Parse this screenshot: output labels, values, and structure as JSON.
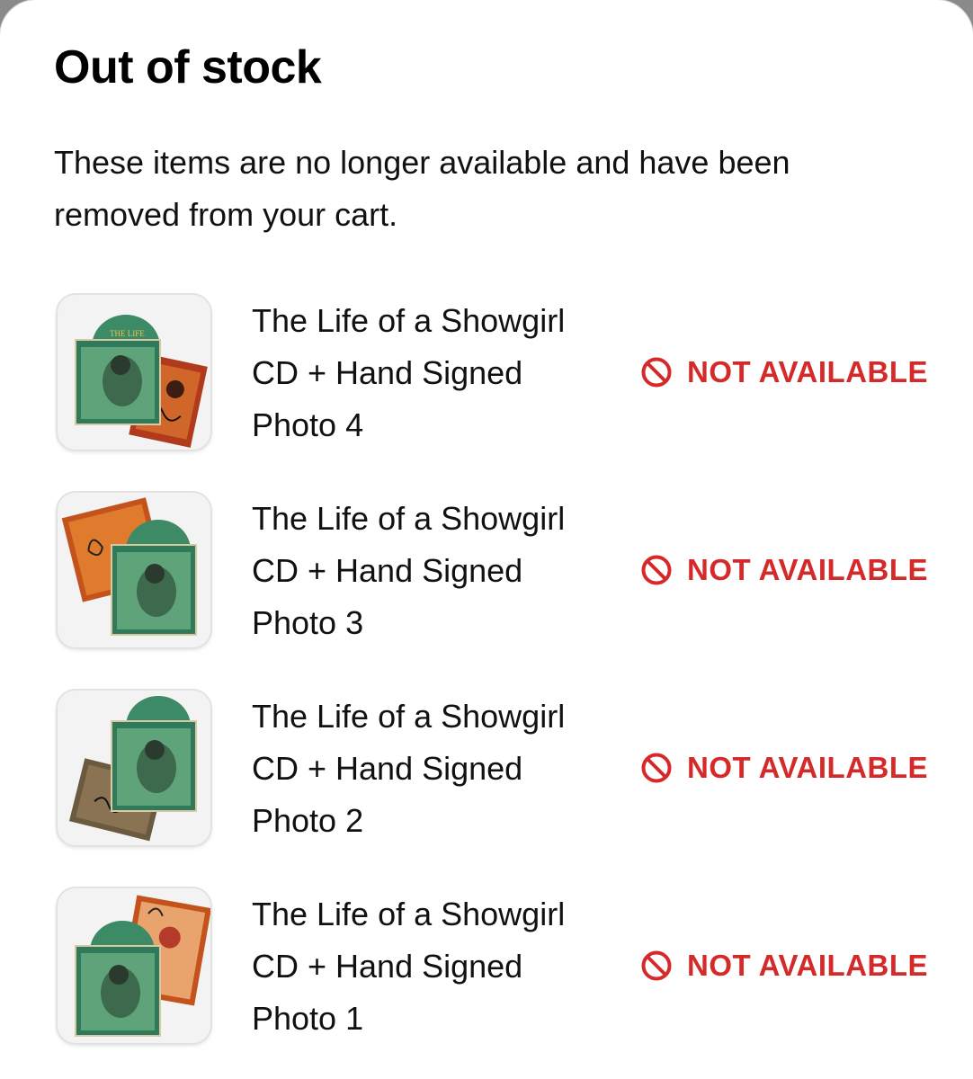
{
  "modal": {
    "title": "Out of stock",
    "message": "These items are no longer available and have been removed from your cart."
  },
  "items": [
    {
      "name": "The Life of a Showgirl CD + Hand Signed Photo 4",
      "status": "NOT AVAILABLE",
      "thumbnail_icon": "album-cd-signed-photo-image"
    },
    {
      "name": "The Life of a Showgirl CD + Hand Signed Photo 3",
      "status": "NOT AVAILABLE",
      "thumbnail_icon": "album-cd-signed-photo-image"
    },
    {
      "name": "The Life of a Showgirl CD + Hand Signed Photo 2",
      "status": "NOT AVAILABLE",
      "thumbnail_icon": "album-cd-signed-photo-image"
    },
    {
      "name": "The Life of a Showgirl CD + Hand Signed Photo 1",
      "status": "NOT AVAILABLE",
      "thumbnail_icon": "album-cd-signed-photo-image"
    }
  ],
  "colors": {
    "status_red": "#d42a2a",
    "text": "#111111",
    "background": "#ffffff",
    "album_green": "#4f9a6a",
    "photo_orange": "#c4521c"
  },
  "icons": {
    "status": "ban-icon"
  }
}
